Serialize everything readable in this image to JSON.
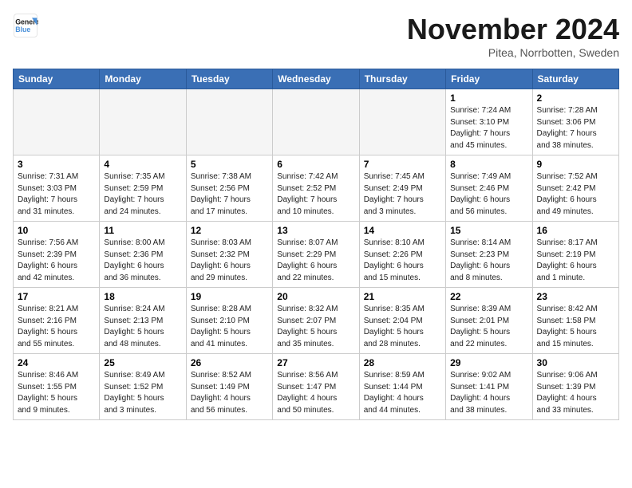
{
  "logo": {
    "line1": "General",
    "line2": "Blue"
  },
  "title": "November 2024",
  "subtitle": "Pitea, Norrbotten, Sweden",
  "days_of_week": [
    "Sunday",
    "Monday",
    "Tuesday",
    "Wednesday",
    "Thursday",
    "Friday",
    "Saturday"
  ],
  "weeks": [
    [
      {
        "day": "",
        "info": "",
        "empty": true
      },
      {
        "day": "",
        "info": "",
        "empty": true
      },
      {
        "day": "",
        "info": "",
        "empty": true
      },
      {
        "day": "",
        "info": "",
        "empty": true
      },
      {
        "day": "",
        "info": "",
        "empty": true
      },
      {
        "day": "1",
        "info": "Sunrise: 7:24 AM\nSunset: 3:10 PM\nDaylight: 7 hours\nand 45 minutes."
      },
      {
        "day": "2",
        "info": "Sunrise: 7:28 AM\nSunset: 3:06 PM\nDaylight: 7 hours\nand 38 minutes."
      }
    ],
    [
      {
        "day": "3",
        "info": "Sunrise: 7:31 AM\nSunset: 3:03 PM\nDaylight: 7 hours\nand 31 minutes."
      },
      {
        "day": "4",
        "info": "Sunrise: 7:35 AM\nSunset: 2:59 PM\nDaylight: 7 hours\nand 24 minutes."
      },
      {
        "day": "5",
        "info": "Sunrise: 7:38 AM\nSunset: 2:56 PM\nDaylight: 7 hours\nand 17 minutes."
      },
      {
        "day": "6",
        "info": "Sunrise: 7:42 AM\nSunset: 2:52 PM\nDaylight: 7 hours\nand 10 minutes."
      },
      {
        "day": "7",
        "info": "Sunrise: 7:45 AM\nSunset: 2:49 PM\nDaylight: 7 hours\nand 3 minutes."
      },
      {
        "day": "8",
        "info": "Sunrise: 7:49 AM\nSunset: 2:46 PM\nDaylight: 6 hours\nand 56 minutes."
      },
      {
        "day": "9",
        "info": "Sunrise: 7:52 AM\nSunset: 2:42 PM\nDaylight: 6 hours\nand 49 minutes."
      }
    ],
    [
      {
        "day": "10",
        "info": "Sunrise: 7:56 AM\nSunset: 2:39 PM\nDaylight: 6 hours\nand 42 minutes."
      },
      {
        "day": "11",
        "info": "Sunrise: 8:00 AM\nSunset: 2:36 PM\nDaylight: 6 hours\nand 36 minutes."
      },
      {
        "day": "12",
        "info": "Sunrise: 8:03 AM\nSunset: 2:32 PM\nDaylight: 6 hours\nand 29 minutes."
      },
      {
        "day": "13",
        "info": "Sunrise: 8:07 AM\nSunset: 2:29 PM\nDaylight: 6 hours\nand 22 minutes."
      },
      {
        "day": "14",
        "info": "Sunrise: 8:10 AM\nSunset: 2:26 PM\nDaylight: 6 hours\nand 15 minutes."
      },
      {
        "day": "15",
        "info": "Sunrise: 8:14 AM\nSunset: 2:23 PM\nDaylight: 6 hours\nand 8 minutes."
      },
      {
        "day": "16",
        "info": "Sunrise: 8:17 AM\nSunset: 2:19 PM\nDaylight: 6 hours\nand 1 minute."
      }
    ],
    [
      {
        "day": "17",
        "info": "Sunrise: 8:21 AM\nSunset: 2:16 PM\nDaylight: 5 hours\nand 55 minutes."
      },
      {
        "day": "18",
        "info": "Sunrise: 8:24 AM\nSunset: 2:13 PM\nDaylight: 5 hours\nand 48 minutes."
      },
      {
        "day": "19",
        "info": "Sunrise: 8:28 AM\nSunset: 2:10 PM\nDaylight: 5 hours\nand 41 minutes."
      },
      {
        "day": "20",
        "info": "Sunrise: 8:32 AM\nSunset: 2:07 PM\nDaylight: 5 hours\nand 35 minutes."
      },
      {
        "day": "21",
        "info": "Sunrise: 8:35 AM\nSunset: 2:04 PM\nDaylight: 5 hours\nand 28 minutes."
      },
      {
        "day": "22",
        "info": "Sunrise: 8:39 AM\nSunset: 2:01 PM\nDaylight: 5 hours\nand 22 minutes."
      },
      {
        "day": "23",
        "info": "Sunrise: 8:42 AM\nSunset: 1:58 PM\nDaylight: 5 hours\nand 15 minutes."
      }
    ],
    [
      {
        "day": "24",
        "info": "Sunrise: 8:46 AM\nSunset: 1:55 PM\nDaylight: 5 hours\nand 9 minutes."
      },
      {
        "day": "25",
        "info": "Sunrise: 8:49 AM\nSunset: 1:52 PM\nDaylight: 5 hours\nand 3 minutes."
      },
      {
        "day": "26",
        "info": "Sunrise: 8:52 AM\nSunset: 1:49 PM\nDaylight: 4 hours\nand 56 minutes."
      },
      {
        "day": "27",
        "info": "Sunrise: 8:56 AM\nSunset: 1:47 PM\nDaylight: 4 hours\nand 50 minutes."
      },
      {
        "day": "28",
        "info": "Sunrise: 8:59 AM\nSunset: 1:44 PM\nDaylight: 4 hours\nand 44 minutes."
      },
      {
        "day": "29",
        "info": "Sunrise: 9:02 AM\nSunset: 1:41 PM\nDaylight: 4 hours\nand 38 minutes."
      },
      {
        "day": "30",
        "info": "Sunrise: 9:06 AM\nSunset: 1:39 PM\nDaylight: 4 hours\nand 33 minutes."
      }
    ]
  ]
}
